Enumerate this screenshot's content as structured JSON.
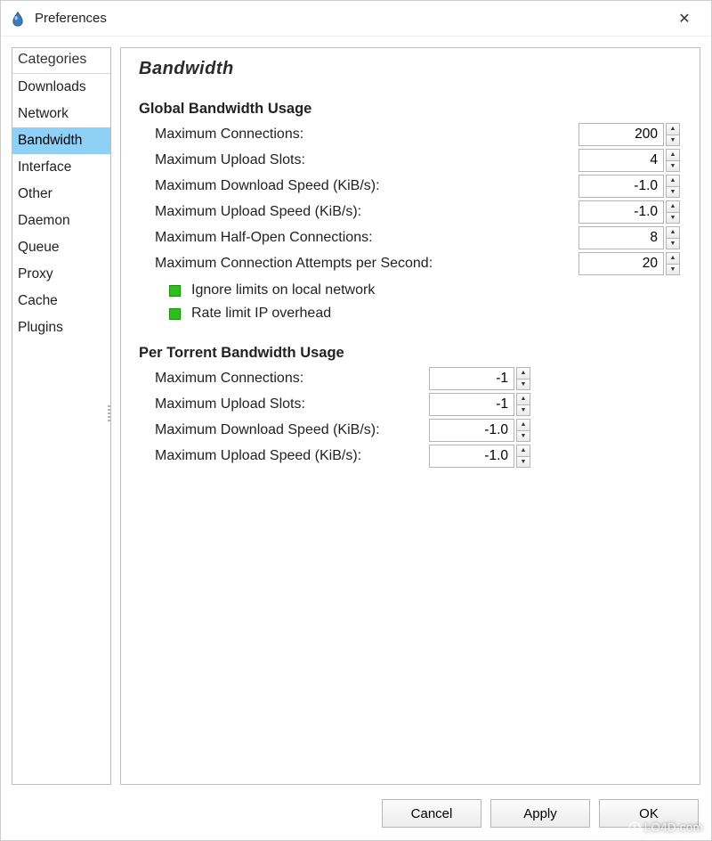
{
  "window": {
    "title": "Preferences"
  },
  "sidebar": {
    "header": "Categories",
    "items": [
      {
        "label": "Downloads",
        "selected": false
      },
      {
        "label": "Network",
        "selected": false
      },
      {
        "label": "Bandwidth",
        "selected": true
      },
      {
        "label": "Interface",
        "selected": false
      },
      {
        "label": "Other",
        "selected": false
      },
      {
        "label": "Daemon",
        "selected": false
      },
      {
        "label": "Queue",
        "selected": false
      },
      {
        "label": "Proxy",
        "selected": false
      },
      {
        "label": "Cache",
        "selected": false
      },
      {
        "label": "Plugins",
        "selected": false
      }
    ]
  },
  "page": {
    "title": "Bandwidth",
    "global": {
      "heading": "Global Bandwidth Usage",
      "fields": {
        "max_connections": {
          "label": "Maximum Connections:",
          "value": "200"
        },
        "max_upload_slots": {
          "label": "Maximum Upload Slots:",
          "value": "4"
        },
        "max_download_speed": {
          "label": "Maximum Download Speed (KiB/s):",
          "value": "-1.0"
        },
        "max_upload_speed": {
          "label": "Maximum Upload Speed (KiB/s):",
          "value": "-1.0"
        },
        "max_half_open": {
          "label": "Maximum Half-Open Connections:",
          "value": "8"
        },
        "max_conn_attempts_sec": {
          "label": "Maximum Connection Attempts per Second:",
          "value": "20"
        }
      },
      "checks": {
        "ignore_local": {
          "label": "Ignore limits on local network",
          "checked": true
        },
        "rate_ip": {
          "label": "Rate limit IP overhead",
          "checked": true
        }
      }
    },
    "per_torrent": {
      "heading": "Per Torrent Bandwidth Usage",
      "fields": {
        "max_connections": {
          "label": "Maximum Connections:",
          "value": "-1"
        },
        "max_upload_slots": {
          "label": "Maximum Upload Slots:",
          "value": "-1"
        },
        "max_download_speed": {
          "label": "Maximum Download Speed (KiB/s):",
          "value": "-1.0"
        },
        "max_upload_speed": {
          "label": "Maximum Upload Speed (KiB/s):",
          "value": "-1.0"
        }
      }
    }
  },
  "buttons": {
    "cancel": "Cancel",
    "apply": "Apply",
    "ok": "OK"
  },
  "watermark": "LO4D.com"
}
